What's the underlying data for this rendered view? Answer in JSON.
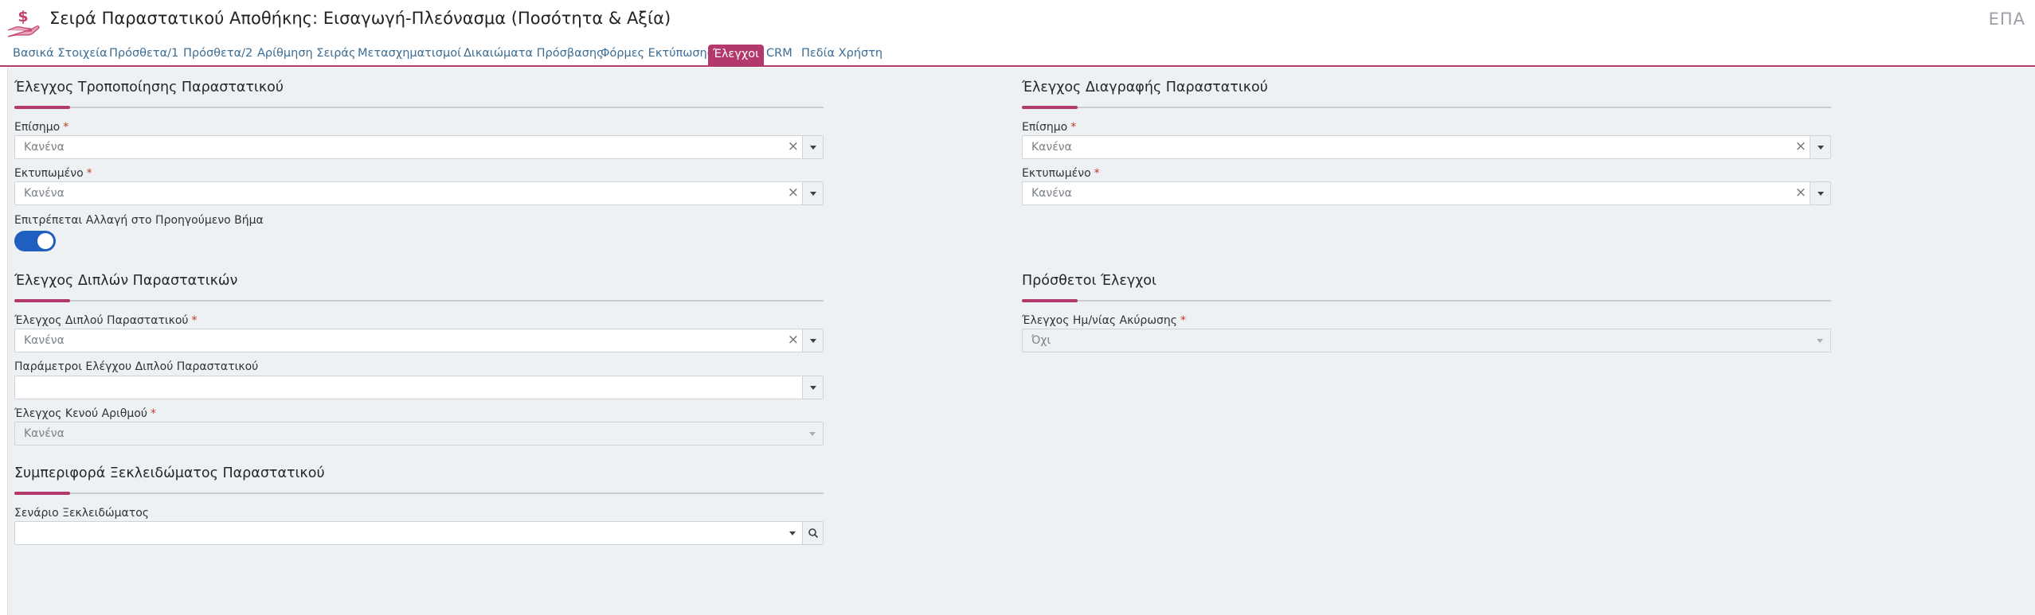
{
  "header": {
    "title": "Σειρά Παραστατικού Αποθήκης: Εισαγωγή-Πλεόνασμα (Ποσότητα & Αξία)",
    "right_code": "ΕΠΑ",
    "icon": "hand-dollar-icon"
  },
  "tabs": [
    {
      "label": "Βασικά Στοιχεία"
    },
    {
      "label": "Πρόσθετα/1"
    },
    {
      "label": "Πρόσθετα/2"
    },
    {
      "label": "Αρίθμηση Σειράς"
    },
    {
      "label": "Μετασχηματισμοί"
    },
    {
      "label": "Δικαιώματα Πρόσβασης"
    },
    {
      "label": "Φόρμες Εκτύπωσης"
    },
    {
      "label": "Έλεγχοι",
      "active": true
    },
    {
      "label": "CRM"
    },
    {
      "label": "Πεδία Χρήστη"
    }
  ],
  "sections": {
    "modify_check": {
      "title": "Έλεγχος Τροποποίησης Παραστατικού",
      "official": {
        "label": "Επίσημο",
        "value": "Κανένα"
      },
      "printed": {
        "label": "Εκτυπωμένο",
        "value": "Κανένα"
      },
      "allow_prev_step": {
        "label": "Επιτρέπεται Αλλαγή στο Προηγούμενο Βήμα",
        "on": true
      }
    },
    "delete_check": {
      "title": "Έλεγχος Διαγραφής Παραστατικού",
      "official": {
        "label": "Επίσημο",
        "value": "Κανένα"
      },
      "printed": {
        "label": "Εκτυπωμένο",
        "value": "Κανένα"
      }
    },
    "duplicate_check": {
      "title": "Έλεγχος Διπλών Παραστατικών",
      "duplicate": {
        "label": "Έλεγχος Διπλού Παραστατικού",
        "value": "Κανένα"
      },
      "parameters": {
        "label": "Παράμετροι Ελέγχου Διπλού Παραστατικού",
        "value": ""
      },
      "empty_number": {
        "label": "Έλεγχος Κενού Αριθμού",
        "value": "Κανένα"
      }
    },
    "extra_checks": {
      "title": "Πρόσθετοι Έλεγχοι",
      "cancel_date": {
        "label": "Έλεγχος Ημ/νίας Ακύρωσης",
        "value": "Όχι"
      }
    },
    "unlock": {
      "title": "Συμπεριφορά Ξεκλειδώματος Παραστατικού",
      "scenario": {
        "label": "Σενάριο Ξεκλειδώματος",
        "value": ""
      }
    }
  },
  "colors": {
    "accent": "#b3386b",
    "toggle_on": "#1f5fbf",
    "required_star": "#c0392b"
  }
}
